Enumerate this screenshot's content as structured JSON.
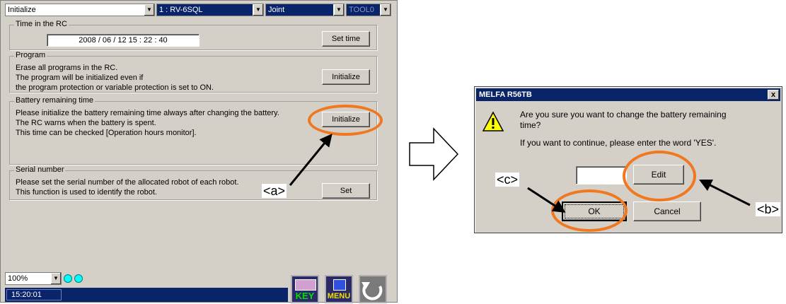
{
  "header": {
    "mode_select": "Initialize",
    "robot_select": "1 : RV-6SQL",
    "jog_select": "Joint",
    "tool_select": "TOOL0"
  },
  "time_group": {
    "title": "Time in the RC",
    "datetime": "2008 / 06 / 12   15 : 22 : 40",
    "set_time_label": "Set time"
  },
  "program_group": {
    "title": "Program",
    "lines": [
      "Erase all programs in the RC.",
      "The program will be initialized even if",
      "the program protection or variable protection is set to ON."
    ],
    "button_label": "Initialize"
  },
  "battery_group": {
    "title": "Battery remaining time",
    "lines": [
      "Please initialize the battery remaining time always after changing the battery.",
      "The RC warns when the battery is spent.",
      "This time can be checked [Operation hours monitor]."
    ],
    "button_label": "Initialize"
  },
  "serial_group": {
    "title": "Serial number",
    "lines": [
      "Please set the serial number of the allocated robot of each robot.",
      "This function is used to identify the robot."
    ],
    "button_label": "Set"
  },
  "footer": {
    "zoom": "100%",
    "clock": "15:20:01",
    "key_label": "KEY",
    "menu_label": "MENU"
  },
  "dialog": {
    "title": "MELFA R56TB",
    "close": "x",
    "message_line1": "Are you sure you want to change the battery remaining",
    "message_line2": "time?",
    "message_line3": "If you want to continue, please enter the word 'YES'.",
    "input_value": "",
    "edit_label": "Edit",
    "ok_label": "OK",
    "cancel_label": "Cancel"
  },
  "annotations": {
    "a": "<a>",
    "b": "<b>",
    "c": "<c>",
    "color": "#f07820"
  }
}
